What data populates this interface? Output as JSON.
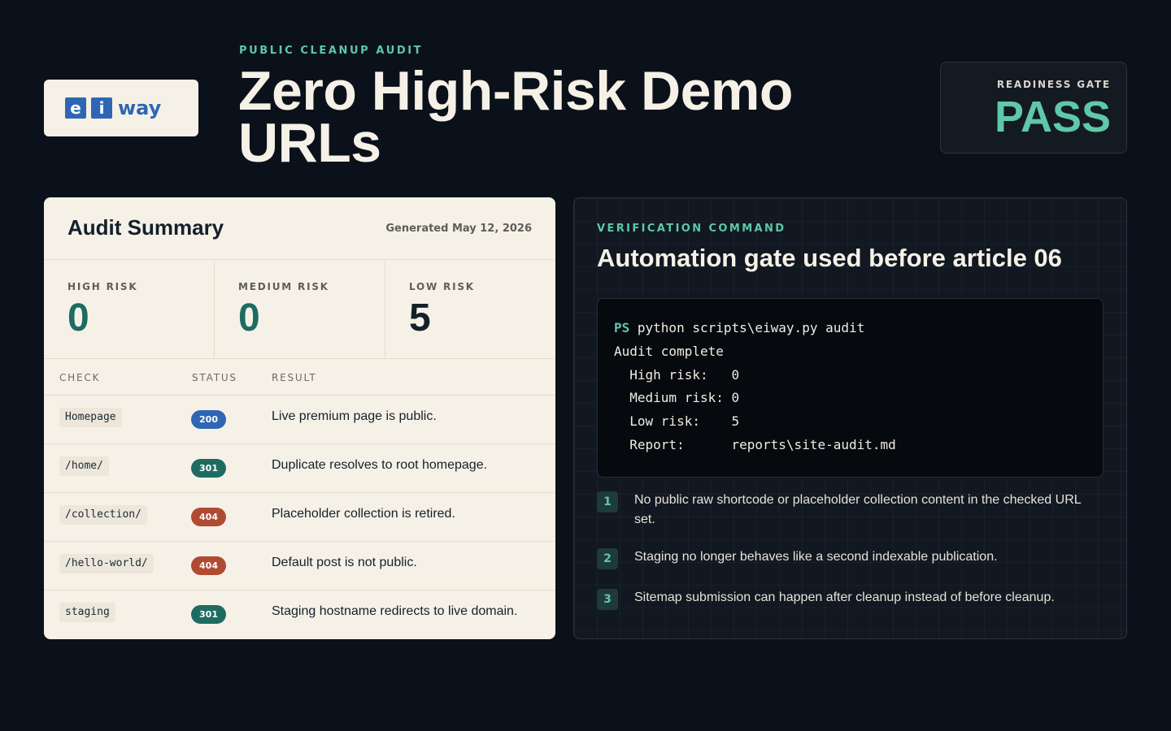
{
  "logo": {
    "letters": [
      "e",
      "i"
    ],
    "word": "way"
  },
  "header": {
    "eyebrow": "PUBLIC CLEANUP AUDIT",
    "title": "Zero High-Risk Demo URLs"
  },
  "gate": {
    "label": "READINESS GATE",
    "value": "PASS"
  },
  "audit": {
    "title": "Audit Summary",
    "generated": "Generated May 12, 2026",
    "metrics": [
      {
        "label": "HIGH RISK",
        "value": "0"
      },
      {
        "label": "MEDIUM RISK",
        "value": "0"
      },
      {
        "label": "LOW RISK",
        "value": "5"
      }
    ],
    "columns": [
      "CHECK",
      "STATUS",
      "RESULT"
    ],
    "rows": [
      {
        "check": "Homepage",
        "status": "200",
        "result": "Live premium page is public."
      },
      {
        "check": "/home/",
        "status": "301",
        "result": "Duplicate resolves to root homepage."
      },
      {
        "check": "/collection/",
        "status": "404",
        "result": "Placeholder collection is retired."
      },
      {
        "check": "/hello-world/",
        "status": "404",
        "result": "Default post is not public."
      },
      {
        "check": "staging",
        "status": "301",
        "result": "Staging hostname redirects to live domain."
      }
    ]
  },
  "verification": {
    "eyebrow": "VERIFICATION COMMAND",
    "title": "Automation gate used before article 06",
    "terminal": {
      "prompt": "PS",
      "command": " python scripts\\eiway.py audit",
      "lines": [
        "Audit complete",
        "  High risk:   0",
        "  Medium risk: 0",
        "  Low risk:    5",
        "  Report:      reports\\site-audit.md"
      ]
    },
    "steps": [
      {
        "num": "1",
        "text": "No public raw shortcode or placeholder collection content in the checked URL set."
      },
      {
        "num": "2",
        "text": "Staging no longer behaves like a second indexable publication."
      },
      {
        "num": "3",
        "text": "Sitemap submission can happen after cleanup instead of before cleanup."
      }
    ]
  },
  "colors": {
    "background": "#0b111a",
    "accent": "#5ec8a8",
    "brand": "#2f66b3",
    "status_200": "#2f66b3",
    "status_301": "#1e6b62",
    "status_404": "#b04a33"
  }
}
